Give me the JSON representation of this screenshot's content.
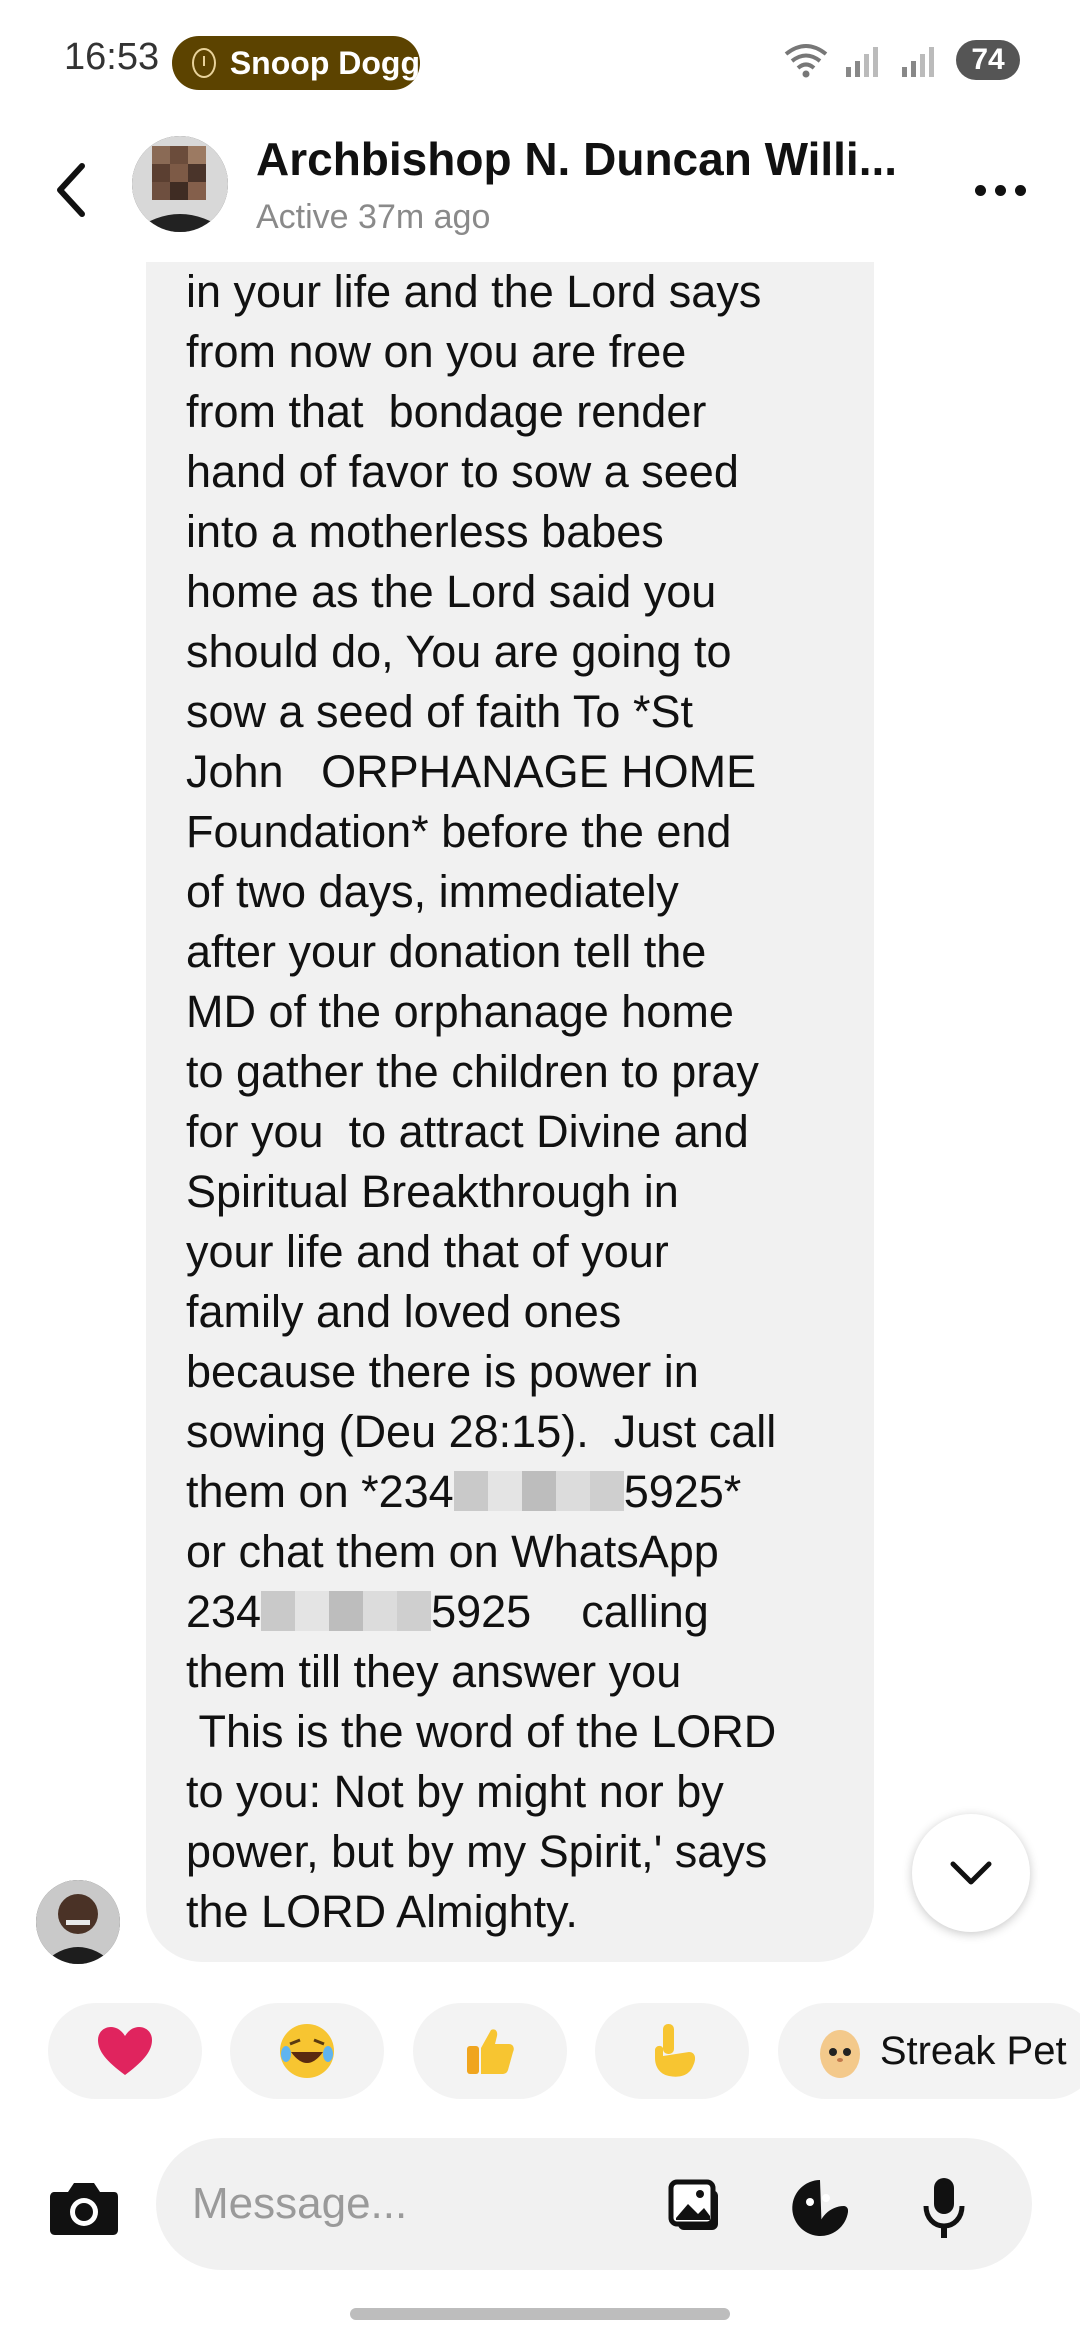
{
  "status_bar": {
    "time": "16:53",
    "now_playing": "Snoop Dogg",
    "battery": "74"
  },
  "header": {
    "contact_name": "Archbishop N. Duncan Willi...",
    "activity": "Active 37m ago",
    "back_icon": "chevron-left-icon",
    "menu_icon": "more-horizontal-icon"
  },
  "message": {
    "lines": [
      "in your life and the Lord says",
      "from now on you are free",
      "from that  bondage render",
      "hand of favor to sow a seed",
      "into a motherless babes",
      "home as the Lord said you",
      "should do, You are going to",
      "sow a seed of faith To *St",
      "John   ORPHANAGE HOME",
      "Foundation* before the end",
      "of two days, immediately",
      "after your donation tell the",
      "MD of the orphanage home",
      "to gather the children to pray",
      "for you  to attract Divine and",
      "Spiritual Breakthrough in",
      "your life and that of your",
      "family and loved ones",
      "because there is power in",
      "sowing (Deu 28:15).  Just call"
    ],
    "phone_line_1_prefix": "them on *234",
    "phone_line_1_suffix": "5925*",
    "line_whatsapp": "or chat them on WhatsApp",
    "phone_line_2_prefix": "234",
    "phone_line_2_suffix": "5925    calling",
    "tail_lines": [
      "them till they answer you",
      " This is the word of the LORD",
      "to you: Not by might nor by",
      "power, but by my Spirit,' says",
      "the LORD Almighty."
    ]
  },
  "reactions": [
    {
      "emoji": "❤️",
      "name": "heart"
    },
    {
      "emoji": "😂",
      "name": "laughing"
    },
    {
      "emoji": "👍",
      "name": "thumbs-up"
    },
    {
      "emoji": "👆",
      "name": "pointing-up"
    }
  ],
  "streak": {
    "emoji": "🥚",
    "label": "Streak Pet"
  },
  "composer": {
    "placeholder": "Message..."
  },
  "colors": {
    "now_playing_pill": "#5c4300",
    "bubble": "#f1f1f1",
    "heart": "#e0245e"
  }
}
